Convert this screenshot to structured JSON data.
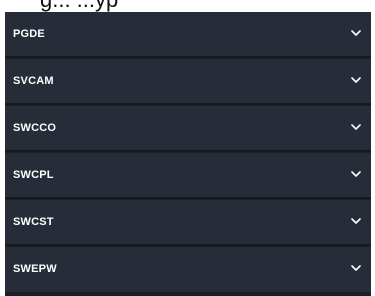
{
  "header": {
    "cropped_text": "g... ...yp"
  },
  "accordion": {
    "items": [
      {
        "label": "PGDE"
      },
      {
        "label": "SVCAM"
      },
      {
        "label": "SWCCO"
      },
      {
        "label": "SWCPL"
      },
      {
        "label": "SWCST"
      },
      {
        "label": "SWEPW"
      }
    ],
    "colors": {
      "item_background": "#262c38",
      "divider": "#151920",
      "text": "#ffffff"
    },
    "icon": "chevron-down-icon"
  }
}
